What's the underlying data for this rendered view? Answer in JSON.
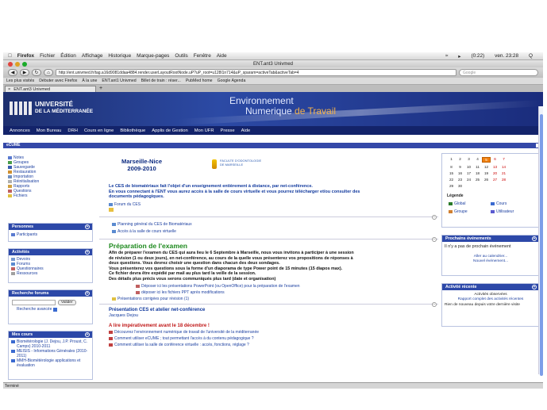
{
  "menubar": {
    "app": "Firefox",
    "items": [
      "Fichier",
      "Édition",
      "Affichage",
      "Historique",
      "Marque-pages",
      "Outils",
      "Fenêtre",
      "Aide"
    ],
    "battery": "(0:22)",
    "clock": "ven. 23:28",
    "search_icon": "Q"
  },
  "window": {
    "title": "ENT.ant3 Univmed"
  },
  "nav": {
    "url": "http://ent.univmed.fr/tag.a16d9081ddaa4884.render.userLayoutRootNode.uP?uP_root=u128l1n714&uP_sparam=activeTab&activeTab=4",
    "search_placeholder": "Google"
  },
  "bookmarks": [
    "Les plus visités",
    "Débuter avec Firefox",
    "À la une",
    "ENT.ant1 Univmed",
    "Billet de train : réser...",
    "PubMed home",
    "Google Agenda"
  ],
  "tab": {
    "label": "ENT.ant3 Univmed",
    "new": "+"
  },
  "banner": {
    "univ_line1": "UNIVERSITÉ",
    "univ_line2": "DE LA MÉDITERRANÉE",
    "env1": "Environnement",
    "env2a": "Numerique ",
    "env2b": "de Travail"
  },
  "navmenu": [
    "Annonces",
    "Mon Bureau",
    "DRH",
    "Cours en ligne",
    "Bibliothèque",
    "Applis de Gestion",
    "Mon UFR",
    "Presse",
    "Aide"
  ],
  "section": {
    "title": "eCUME"
  },
  "left": {
    "tools": [
      "Notes",
      "Groupes",
      "Sauvegarde",
      "Restauration",
      "Importation",
      "Réinitialisation",
      "Rapports",
      "Questions",
      "Fichiers"
    ],
    "personnes": {
      "title": "Personnes",
      "items": [
        "Participants"
      ]
    },
    "activites": {
      "title": "Activités",
      "items": [
        "Devoirs",
        "Forums",
        "Questionnaires",
        "Ressources"
      ]
    },
    "forums": {
      "title": "Recherche forums",
      "button": "Valider",
      "advanced": "Recherche avancée"
    },
    "cours": {
      "title": "Mes cours",
      "items": [
        "Biométérologie (J. Dejou, J.P. Proust, C. Camps) 2010-2011",
        "MEISIS - Informations Générales (2010-2011)",
        "MMH-Biométérologie applications et évaluation"
      ]
    }
  },
  "main": {
    "title1": "Marseille-Nice",
    "title2": "2009-2010",
    "faculty1": "FACULTE D'ODONTOLOGIE",
    "faculty2": "DE MARSEILLE",
    "intro": [
      "Le CES de biomatériaux fait l'objet d'un enseignement entièrement à distance, par net-conférence.",
      "En vous connectant à l'ENT vous aurez accès à la salle de cours virtuelle et vous pourrez télécharger et/ou consulter des",
      "documents pédagogiques."
    ],
    "forum_link": "Forum du CES",
    "plan_links": [
      "Planning général du CES de Biomatériaux",
      "Accès à la salle de cours virtuelle"
    ],
    "prep_title": "Préparation de l'examen",
    "prep_text": [
      "Afin de préparer l'examen du CES qui aura lieu le 6 Septembre à Marseille, nous vous invitons à participer à une session",
      "de révision (1 ou deux jours), en net-conférence, au cours de la quelle vous présenterez vos propositions de réponses à",
      "deux questions. Vous devrez choisir une question dans chacun des deux sondages.",
      "Vous présenterez vos questions sous la forme d'un diaporama de type Power point de 15 minutes (15 diapos max).",
      "Ce fichier devra être expédié par mail au plus tard la veille de la session.",
      "Des détails plus précis vous serons communiqués plus tard (date et organisation)"
    ],
    "prep_links": [
      "Déposer ici les présentations PowerPoint (ou OpenOffice) pour la préparation de l'examen",
      "déposer ici les fichiers PPT après modifications",
      "Présentations corrigées pour révision (1)"
    ],
    "pres_title": "Présentation CES et atelier net-conférence",
    "pres_author": "Jacques Dejou",
    "important": "A lire impérativement avant le 18 décembre !",
    "important_links": [
      "Découvrez l'environnement numérique de travail de l'université de la méditerranée",
      "Comment utiliser eCUME ; tout permettant l'accès à du contenu pédagogique ?",
      "Comment utiliser la salle de conférence virtuelle : accès, fonctions, réglage ?"
    ]
  },
  "right": {
    "calendar": [
      [
        "1",
        "2",
        "3",
        "4",
        "5",
        "6",
        "7"
      ],
      [
        "8",
        "9",
        "10",
        "11",
        "12",
        "13",
        "14"
      ],
      [
        "15",
        "16",
        "17",
        "18",
        "19",
        "20",
        "21"
      ],
      [
        "22",
        "23",
        "24",
        "25",
        "26",
        "27",
        "28"
      ],
      [
        "29",
        "30",
        "",
        "",
        "",
        "",
        ""
      ]
    ],
    "legend_title": "Légende",
    "legend": [
      "Global",
      "Cours",
      "Groupe",
      "Utilisateur"
    ],
    "events": {
      "title": "Prochains événements",
      "text": "Il n'y a pas de prochain événement",
      "link1": "Aller au calendrier...",
      "link2": "Nouvel événement..."
    },
    "activity": {
      "title": "Activité récente",
      "line1": "Activités observées",
      "line2": "Rapport complet des activités récentes",
      "line3": "Rien de nouveau depuis votre dernière visite"
    }
  },
  "status": "Terminé"
}
